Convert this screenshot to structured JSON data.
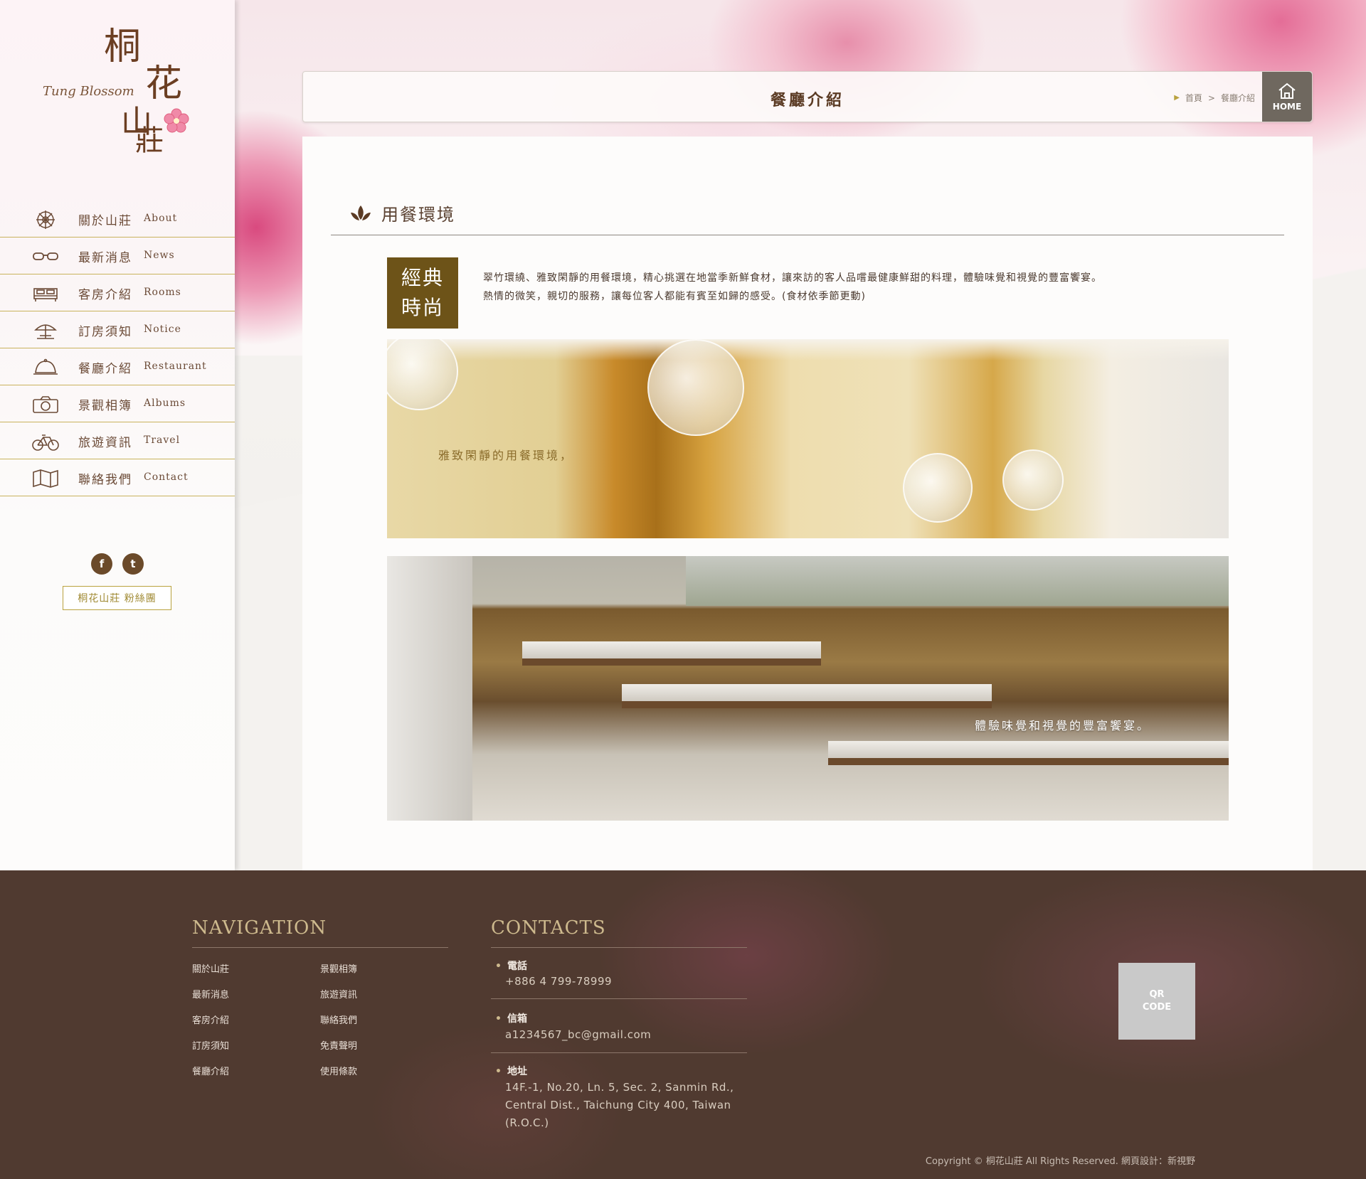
{
  "brand": {
    "name_zh": "桐花山莊",
    "name_en": "Tung Blossom"
  },
  "sidebar": {
    "items": [
      {
        "zh": "關於山莊",
        "en": "About",
        "icon": "wheel-icon"
      },
      {
        "zh": "最新消息",
        "en": "News",
        "icon": "glasses-icon"
      },
      {
        "zh": "客房介紹",
        "en": "Rooms",
        "icon": "bed-icon"
      },
      {
        "zh": "訂房須知",
        "en": "Notice",
        "icon": "beach-umbrella-icon"
      },
      {
        "zh": "餐廳介紹",
        "en": "Restaurant",
        "icon": "cloche-icon"
      },
      {
        "zh": "景觀相簿",
        "en": "Albums",
        "icon": "camera-icon"
      },
      {
        "zh": "旅遊資訊",
        "en": "Travel",
        "icon": "bicycle-icon"
      },
      {
        "zh": "聯絡我們",
        "en": "Contact",
        "icon": "map-icon"
      }
    ],
    "social": {
      "facebook": "f",
      "twitter": "t"
    },
    "fan_button": "桐花山莊 粉絲團"
  },
  "header": {
    "title": "餐廳介紹",
    "breadcrumb": [
      "首頁",
      ">",
      "餐廳介紹"
    ],
    "home_label": "HOME"
  },
  "main": {
    "section_title": "用餐環境",
    "badge_line1": "經典",
    "badge_line2": "時尚",
    "intro_line1": "翠竹環繞、雅致閑靜的用餐環境，精心挑選在地當季新鮮食材，讓來訪的客人品嚐最健康鮮甜的料理，體驗味覺和視覺的豐富饗宴。",
    "intro_line2": "熱情的微笑，親切的服務，讓每位客人都能有賓至如歸的感受。(食材依季節更動)",
    "photo1_caption": "雅致閑靜的用餐環境，",
    "photo2_caption": "體驗味覺和視覺的豐富饗宴。"
  },
  "footer": {
    "nav_title": "NAVIGATION",
    "nav_col1": [
      "關於山莊",
      "最新消息",
      "客房介紹",
      "訂房須知",
      "餐廳介紹"
    ],
    "nav_col2": [
      "景觀相簿",
      "旅遊資訊",
      "聯絡我們",
      "免責聲明",
      "使用條款"
    ],
    "contacts_title": "CONTACTS",
    "phone_label": "電話",
    "phone": "+886 4 799-78999",
    "email_label": "信箱",
    "email": "a1234567_bc@gmail.com",
    "address_label": "地址",
    "address_lines": [
      "14F.-1, No.20, Ln. 5, Sec. 2, Sanmin Rd.,",
      "Central Dist., Taichung City 400, Taiwan",
      "(R.O.C.)"
    ],
    "qr_line1": "QR",
    "qr_line2": "CODE",
    "copyright": "Copyright © 桐花山莊 All Rights Reserved.    網頁設計：新視野"
  },
  "colors": {
    "accent_gold": "#c9b35d",
    "brown": "#6d5318",
    "footer_bg": "#503a30"
  }
}
